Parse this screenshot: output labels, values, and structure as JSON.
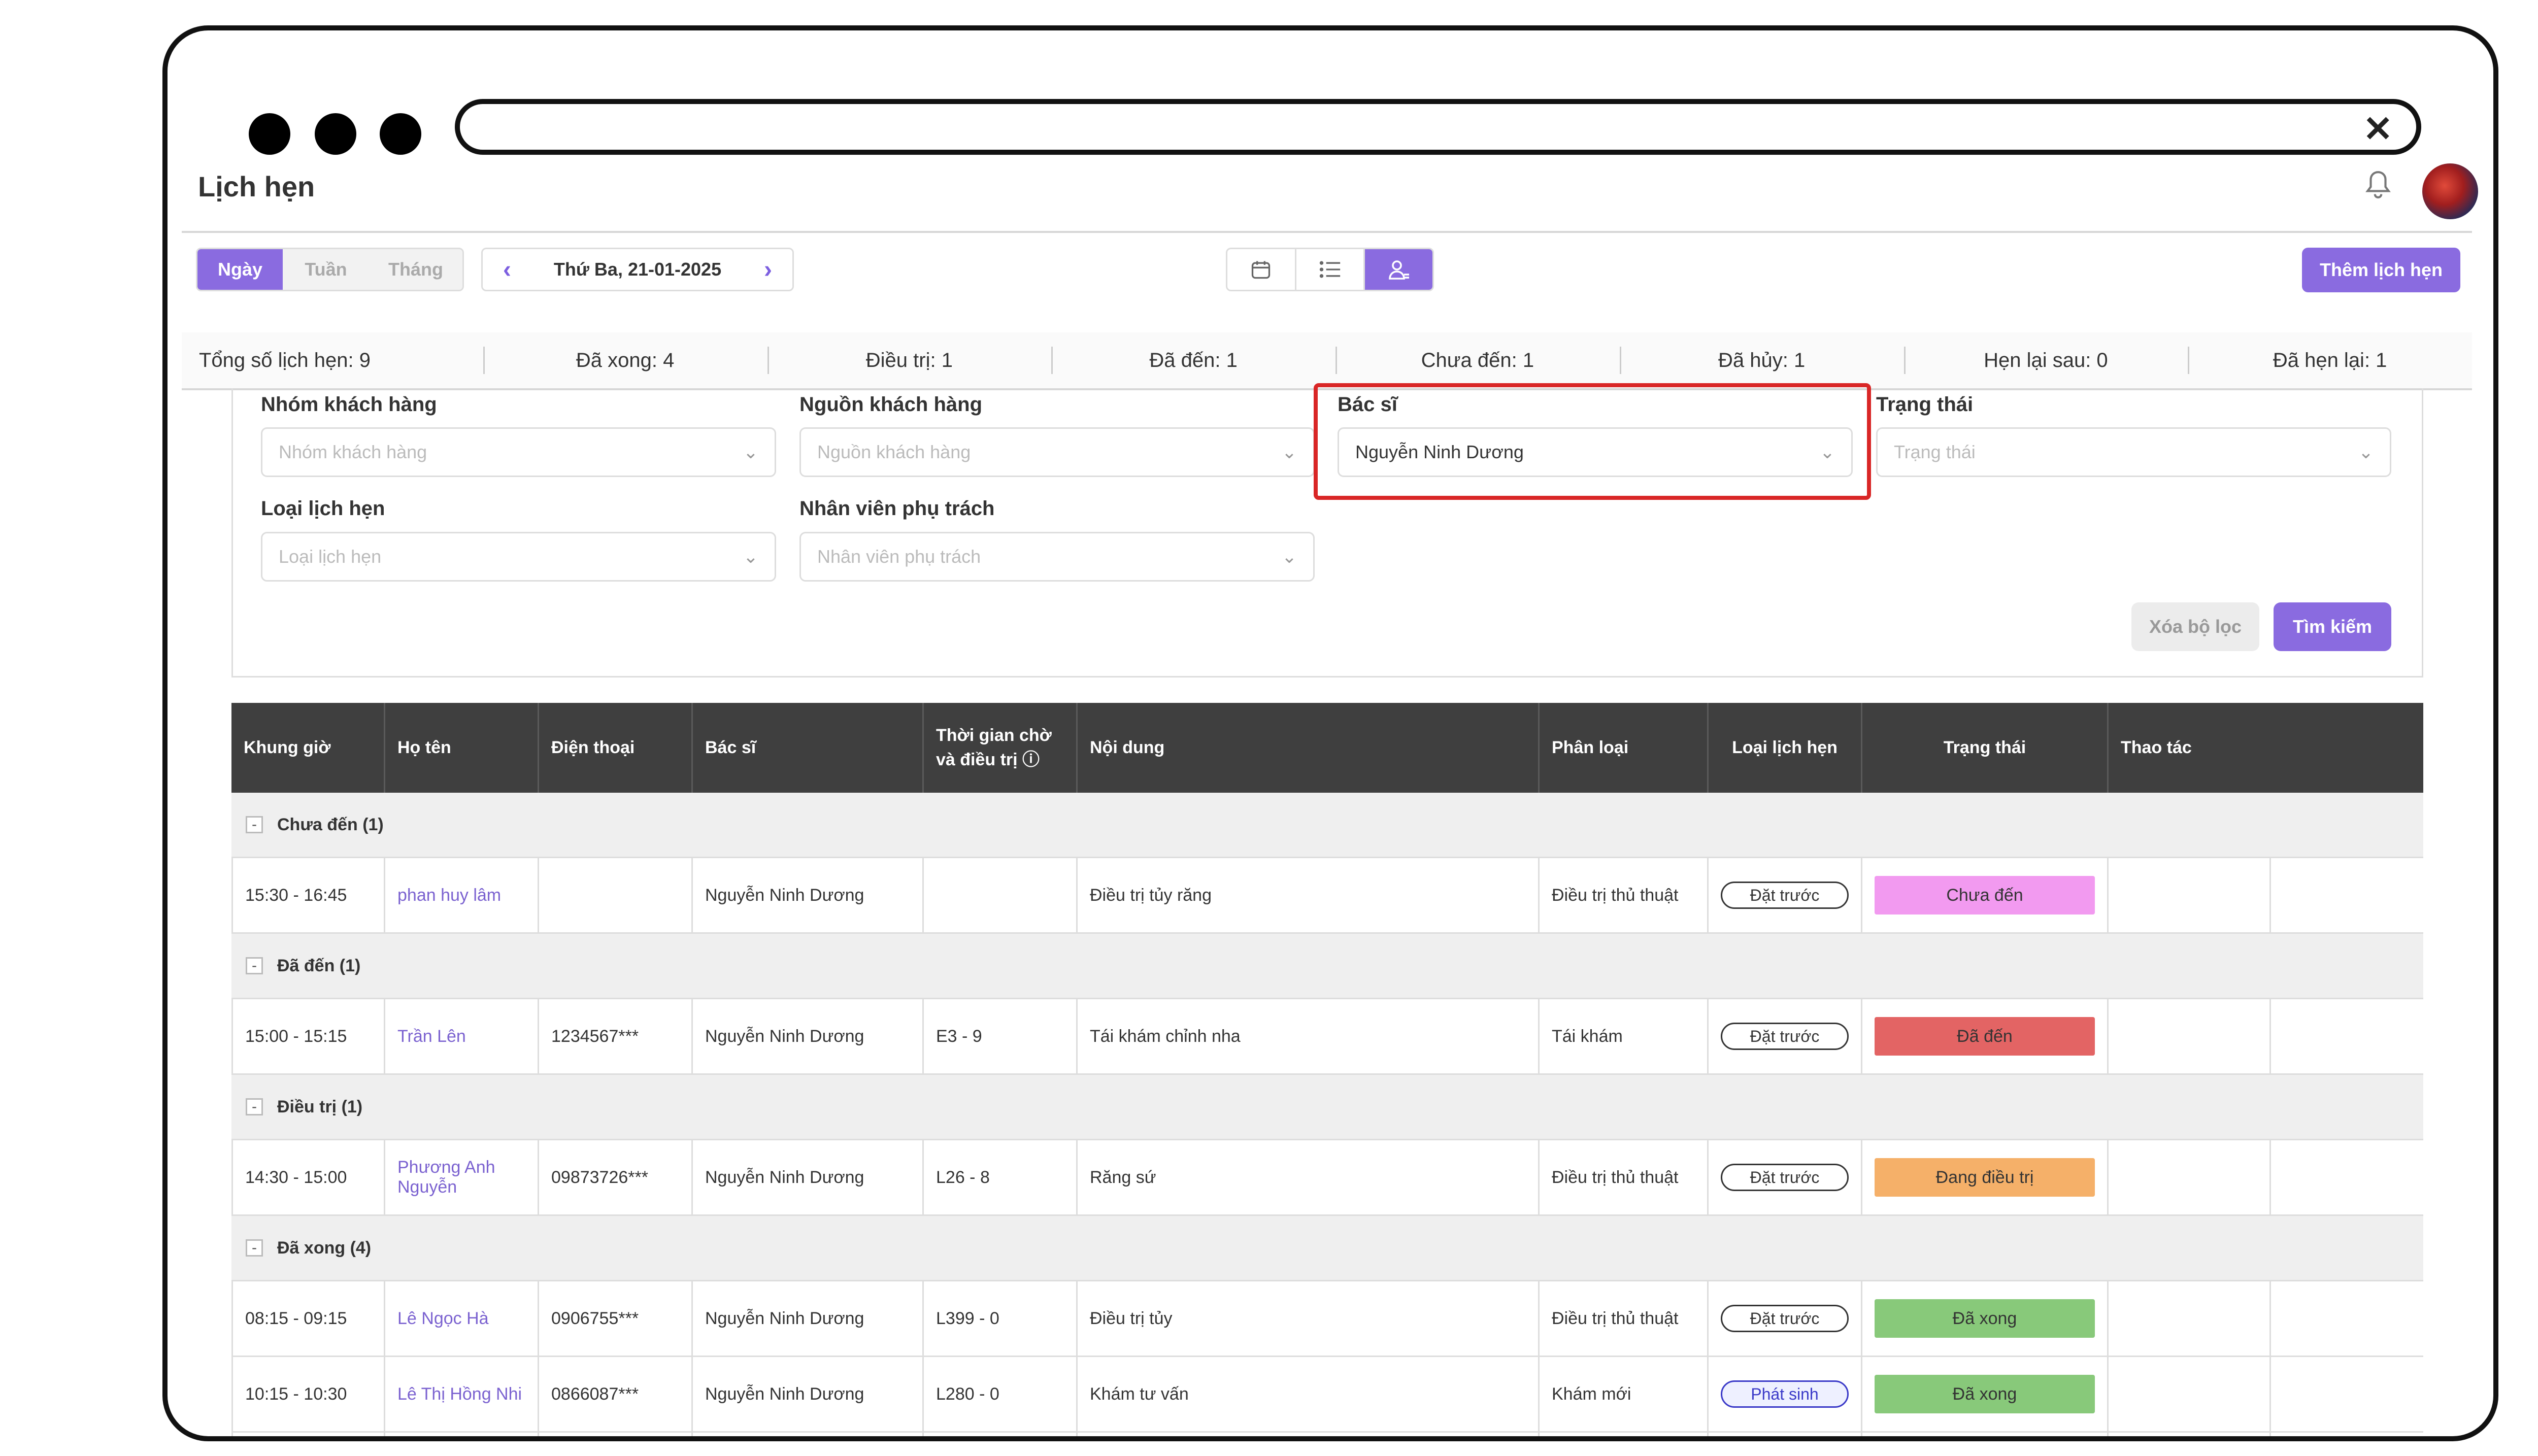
{
  "page": {
    "title": "Lịch hẹn"
  },
  "window": {
    "close_glyph": "✕"
  },
  "toolbar": {
    "views": [
      "Ngày",
      "Tuần",
      "Tháng"
    ],
    "active_view": "Ngày",
    "date": "Thứ Ba, 21-01-2025",
    "add_button": "Thêm lịch hẹn",
    "view_icons": [
      "calendar-icon",
      "list-icon",
      "doctor-icon"
    ]
  },
  "stats": [
    "Tổng số lịch hẹn: 9",
    "Đã xong: 4",
    "Điều trị: 1",
    "Đã đến: 1",
    "Chưa đến: 1",
    "Đã hủy: 1",
    "Hẹn lại sau: 0",
    "Đã hẹn lại: 1"
  ],
  "filters": {
    "customer_group": {
      "label": "Nhóm khách hàng",
      "placeholder": "Nhóm khách hàng"
    },
    "customer_source": {
      "label": "Nguồn khách hàng",
      "placeholder": "Nguồn khách hàng"
    },
    "doctor": {
      "label": "Bác sĩ",
      "value": "Nguyễn Ninh Dương"
    },
    "status": {
      "label": "Trạng thái",
      "placeholder": "Trạng thái"
    },
    "appointment_type": {
      "label": "Loại lịch hẹn",
      "placeholder": "Loại lịch hẹn"
    },
    "staff": {
      "label": "Nhân viên phụ trách",
      "placeholder": "Nhân viên phụ trách"
    },
    "clear_button": "Xóa bộ lọc",
    "search_button": "Tìm kiếm"
  },
  "table": {
    "headers": [
      "Khung giờ",
      "Họ tên",
      "Điện thoại",
      "Bác sĩ",
      "Thời gian chờ và điều trị ⓘ",
      "Nội dung",
      "Phân loại",
      "Loại lịch hẹn",
      "Trạng thái",
      "Thao tác"
    ],
    "groups": [
      {
        "label": "Chưa đến (1)",
        "rows": [
          {
            "time": "15:30 - 16:45",
            "name": "phan huy lâm",
            "phone": "",
            "doctor": "Nguyễn Ninh Dương",
            "wait": "",
            "content": "Điều trị tủy răng",
            "category": "Điều trị thủ thuật",
            "type": "Đặt trước",
            "status": "Chưa đến",
            "status_color": "#f29af0"
          }
        ]
      },
      {
        "label": "Đã đến (1)",
        "rows": [
          {
            "time": "15:00 - 15:15",
            "name": "Trần Lên",
            "phone": "1234567***",
            "doctor": "Nguyễn Ninh Dương",
            "wait": "E3 - 9",
            "content": "Tái khám chỉnh nha",
            "category": "Tái khám",
            "type": "Đặt trước",
            "status": "Đã đến",
            "status_color": "#e36464"
          }
        ]
      },
      {
        "label": "Điều trị (1)",
        "rows": [
          {
            "time": "14:30 - 15:00",
            "name": "Phương Anh Nguyễn",
            "phone": "09873726***",
            "doctor": "Nguyễn Ninh Dương",
            "wait": "L26 - 8",
            "content": "Răng sứ",
            "category": "Điều trị thủ thuật",
            "type": "Đặt trước",
            "status": "Đang điều trị",
            "status_color": "#f5b069"
          }
        ]
      },
      {
        "label": "Đã xong (4)",
        "rows": [
          {
            "time": "08:15 - 09:15",
            "name": "Lê Ngọc Hà",
            "phone": "0906755***",
            "doctor": "Nguyễn Ninh Dương",
            "wait": "L399 - 0",
            "content": "Điều trị tủy",
            "category": "Điều trị thủ thuật",
            "type": "Đặt trước",
            "status": "Đã xong",
            "status_color": "#88c97a"
          },
          {
            "time": "10:15 - 10:30",
            "name": "Lê Thị Hồng Nhi",
            "phone": "0866087***",
            "doctor": "Nguyễn Ninh Dương",
            "wait": "L280 - 0",
            "content": "Khám tư vấn",
            "category": "Khám mới",
            "type": "Phát sinh",
            "status": "Đã xong",
            "status_color": "#88c97a"
          }
        ]
      }
    ]
  }
}
